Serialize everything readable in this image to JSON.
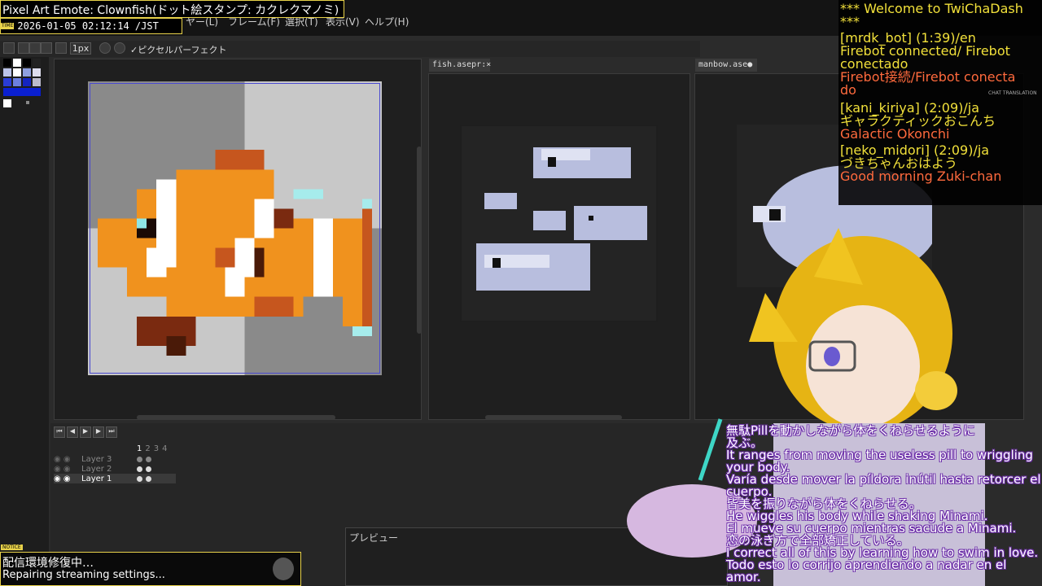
{
  "stream": {
    "title": "Pixel Art Emote: Clownfish(ドット絵スタンプ: カクレクマノミ)",
    "title_badge": "TITLE",
    "time_badge": "TIME",
    "datetime": "2026-01-05 02:12:14 /JST"
  },
  "menu": {
    "layer": "ヤー(L)",
    "frame": "フレーム(F)",
    "select": "選択(T)",
    "view": "表示(V)",
    "help": "ヘルプ(H)"
  },
  "toolbar": {
    "brush_size": "1px",
    "pixel_perfect": "ピクセルパーフェクト"
  },
  "tabs": [
    {
      "label": "fish.asepr:×"
    },
    {
      "label": "manbow.ase●"
    }
  ],
  "layers": {
    "frames": [
      "1",
      "2",
      "3",
      "4"
    ],
    "items": [
      {
        "label": "Layer 3"
      },
      {
        "label": "Layer 2"
      },
      {
        "label": "Layer 1"
      }
    ]
  },
  "preview": {
    "label": "プレビュー"
  },
  "chat": {
    "header_line1": "*** Welcome to TwiChaDash",
    "header_line2": "***",
    "translation_badge": "CHAT TRANSLATION",
    "messages": [
      {
        "user": "[mrdk_bot] (1:39)/en",
        "text1": "Firebot connected/ Firebot",
        "text2": "conectado",
        "tr1": "Firebot接続/Firebot conecta",
        "tr2": "do"
      },
      {
        "user": "[kani_kiriya] (2:09)/ja",
        "text1": "ギャラクティックおこんち",
        "tr1": "Galactic Okonchi"
      },
      {
        "user": "[neko_midori] (2:09)/ja",
        "text1": "づきちゃんおはよう",
        "tr1": "Good morning Zuki-chan"
      }
    ]
  },
  "subtitles": [
    "無駄Pillを動かしながら体をくねらせるように",
    "及ぶ。",
    "It ranges from moving the useless pill to wriggling",
    "your body.",
    "Varía desde mover la píldora inútil hasta retorcer el",
    "cuerpo.",
    "皆美を振りながら体をくねらせる。",
    "He wiggles his body while shaking Minami.",
    "El mueve su cuerpo mientras sacude a Minami.",
    "恋の泳ぎ方で全部矯正している。",
    "I correct all of this by learning how to swim in love.",
    "Todo esto lo corrijo aprendiendo a nadar en el",
    "amor."
  ],
  "notice": {
    "badge": "NOTICE",
    "line1": "配信環境修復中…",
    "line2": "Repairing streaming settings..."
  },
  "colors": {
    "accent": "#e8d24a",
    "chat_user": "#f1e03a",
    "chat_translation": "#ff6a3d",
    "clownfish_orange": "#f0921e",
    "clownfish_white": "#ffffff",
    "fish_blue": "#b8bede"
  }
}
